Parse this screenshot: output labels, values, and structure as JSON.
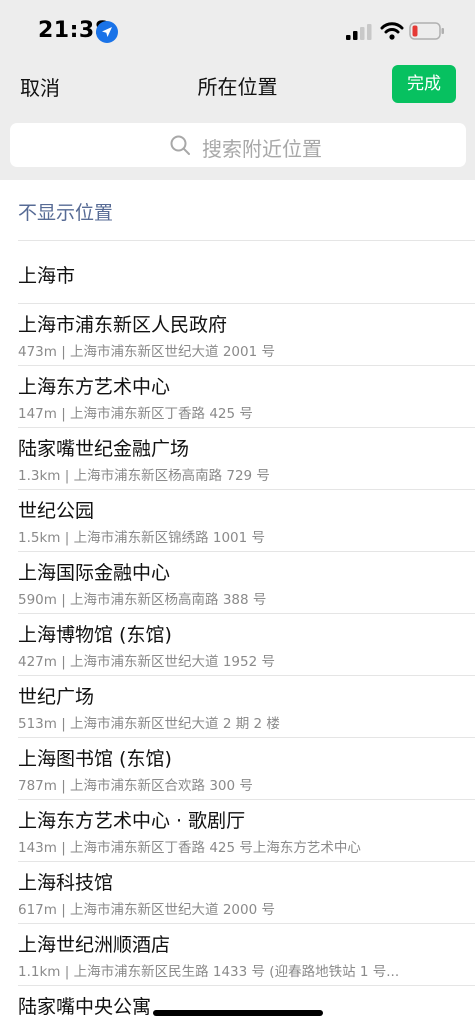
{
  "status_bar": {
    "time": "21:38"
  },
  "nav": {
    "cancel_label": "取消",
    "title": "所在位置",
    "done_label": "完成"
  },
  "search": {
    "placeholder": "搜索附近位置"
  },
  "hide_location_label": "不显示位置",
  "city": "上海市",
  "places": [
    {
      "name": "上海市浦东新区人民政府",
      "detail": "473m | 上海市浦东新区世纪大道 2001 号"
    },
    {
      "name": "上海东方艺术中心",
      "detail": "147m | 上海市浦东新区丁香路 425 号"
    },
    {
      "name": "陆家嘴世纪金融广场",
      "detail": "1.3km | 上海市浦东新区杨高南路 729 号"
    },
    {
      "name": "世纪公园",
      "detail": "1.5km | 上海市浦东新区锦绣路 1001 号"
    },
    {
      "name": "上海国际金融中心",
      "detail": "590m | 上海市浦东新区杨高南路 388 号"
    },
    {
      "name": "上海博物馆 (东馆)",
      "detail": "427m | 上海市浦东新区世纪大道 1952 号"
    },
    {
      "name": "世纪广场",
      "detail": "513m | 上海市浦东新区世纪大道 2 期 2 楼"
    },
    {
      "name": "上海图书馆 (东馆)",
      "detail": "787m | 上海市浦东新区合欢路 300 号"
    },
    {
      "name": "上海东方艺术中心 · 歌剧厅",
      "detail": "143m | 上海市浦东新区丁香路 425 号上海东方艺术中心"
    },
    {
      "name": "上海科技馆",
      "detail": "617m | 上海市浦东新区世纪大道 2000 号"
    },
    {
      "name": "上海世纪洲顺酒店",
      "detail": "1.1km | 上海市浦东新区民生路 1433 号 (迎春路地铁站 1 号..."
    },
    {
      "name": "陆家嘴中央公寓",
      "detail": ""
    }
  ],
  "colors": {
    "accent_green": "#07c160",
    "link_blue": "#576b95",
    "nav_bg": "#ededed"
  }
}
